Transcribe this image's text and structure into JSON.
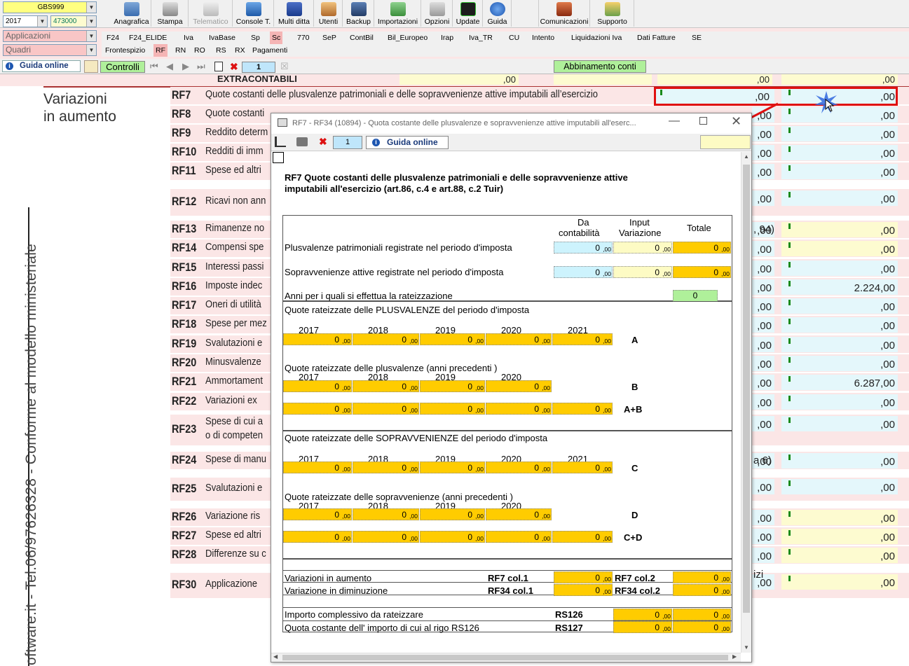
{
  "toolbar": {
    "company_code": "GBS999",
    "year": "2017",
    "code": "473000",
    "applications_label": "Applicazioni",
    "quadri_label": "Quadri",
    "buttons": [
      {
        "label": "Anagrafica",
        "icon": "address-book-icon"
      },
      {
        "label": "Stampa",
        "icon": "printer-icon"
      },
      {
        "label": "Telematico",
        "icon": "telematic-icon"
      },
      {
        "label": "Console T.",
        "icon": "console-icon"
      },
      {
        "label": "Multi ditta",
        "icon": "multi-company-icon"
      },
      {
        "label": "Utenti",
        "icon": "users-icon"
      },
      {
        "label": "Backup",
        "icon": "backup-icon"
      },
      {
        "label": "Importazioni",
        "icon": "import-icon"
      },
      {
        "label": "Opzioni",
        "icon": "wrench-icon"
      },
      {
        "label": "Update",
        "icon": "update-icon"
      },
      {
        "label": "Guida",
        "icon": "help-icon"
      },
      {
        "label": "Comunicazioni",
        "icon": "communications-icon"
      },
      {
        "label": "Supporto",
        "icon": "support-icon"
      }
    ]
  },
  "tabs1": [
    "F24",
    "F24_ELIDE",
    "Iva",
    "IvaBase",
    "Sp",
    "Sc",
    "770",
    "SeP",
    "ContBil",
    "Bil_Europeo",
    "Irap",
    "Iva_TR",
    "CU",
    "Intento",
    "Liquidazioni Iva",
    "Dati Fatture",
    "SE"
  ],
  "tabs2": [
    "Frontespizio",
    "RF",
    "RN",
    "RO",
    "RS",
    "RX",
    "Pagamenti"
  ],
  "navrow": {
    "guida_label": "Guida online",
    "controlli_label": "Controlli",
    "page": "1",
    "abbinamento_label": "Abbinamento conti"
  },
  "form": {
    "sidebar_text": "oftware.it - Tel.06/97626328 - Conforme al modello ministeriale",
    "section_title_1": "Variazioni",
    "section_title_2": "in aumento",
    "extra_label": "EXTRACONTABILI",
    "zero": ",00",
    "rows": [
      {
        "code": "RF7",
        "desc": "Quote costanti delle plusvalenze patrimoniali e delle sopravvenienze attive imputabili all’esercizio",
        "value": ",00"
      },
      {
        "code": "RF8",
        "desc": "Quote costanti",
        "value": ",00"
      },
      {
        "code": "RF9",
        "desc": "Reddito determ",
        "value": ",00"
      },
      {
        "code": "RF10",
        "desc": "Redditi di imm",
        "value": ",00"
      },
      {
        "code": "RF11",
        "desc": "Spese ed altri",
        "value": ",00"
      },
      {
        "code": "RF12",
        "desc": "Ricavi non ann",
        "value": ",00"
      },
      {
        "code": "RF13",
        "desc": "Rimanenze no",
        "value": ",00"
      },
      {
        "code": "RF14",
        "desc": "Compensi spe",
        "value": ",00"
      },
      {
        "code": "RF15",
        "desc": "Interessi passi",
        "value": ",00"
      },
      {
        "code": "RF16",
        "desc": "Imposte indec",
        "value": "2.224,00"
      },
      {
        "code": "RF17",
        "desc": "Oneri di utilità",
        "value": ",00"
      },
      {
        "code": "RF18",
        "desc": "Spese per mez",
        "value": ",00"
      },
      {
        "code": "RF19",
        "desc": "Svalutazioni e",
        "value": ",00"
      },
      {
        "code": "RF20",
        "desc": "Minusvalenze",
        "value": ",00"
      },
      {
        "code": "RF21",
        "desc": "Ammortament",
        "value": "6.287,00"
      },
      {
        "code": "RF22",
        "desc": "Variazioni ex",
        "value": ",00"
      },
      {
        "code": "RF23",
        "desc": "Spese di cui a",
        "desc2": "o di competen",
        "value": ",00"
      },
      {
        "code": "RF24",
        "desc": "Spese di manu",
        "value": ",00"
      },
      {
        "code": "RF25",
        "desc": "Svalutazioni e",
        "value": ",00"
      },
      {
        "code": "RF26",
        "desc": "Variazione ris",
        "value": ",00"
      },
      {
        "code": "RF27",
        "desc": "Spese ed altri",
        "value": ",00"
      },
      {
        "code": "RF28",
        "desc": "Differenze su c",
        "value": ",00"
      },
      {
        "code": "RF30",
        "desc": "Applicazione",
        "value": ",00"
      }
    ],
    "partial_94": ", 94)",
    "partial_a6": "a 6)",
    "partial_izi": "izi",
    "partial_5": "5)",
    "partial_rf8_mid": "0 / "
  },
  "dialog": {
    "title": "RF7 - RF34 (10894) - Quota costante delle plusvalenze e sopravvenienze attive imputabili all'eserc...",
    "page": "1",
    "guida_label": "Guida online",
    "heading_1": "RF7 Quote costanti delle plusvalenze patrimoniali e delle sopravvenienze attive",
    "heading_2": "imputabili all'esercizio (art.86, c.4 e art.88, c.2 Tuir)",
    "col_da_1": "Da",
    "col_da_2": "contabilità",
    "col_input_1": "Input",
    "col_input_2": "Variazione",
    "col_totale": "Totale",
    "row_plus": "Plusvalenze patrimoniali registrate nel periodo d'imposta",
    "row_sopr": "Sopravvenienze attive registrate nel periodo d'imposta",
    "row_anni": "Anni per i quali si effettua la rateizzazione",
    "anni_value": "0",
    "zero": "0",
    "cents": ",00",
    "sec_plus_cur": "Quote rateizzate delle PLUSVALENZE del periodo d'imposta",
    "sec_plus_prev": "Quote rateizzate delle plusvalenze  (anni precedenti )",
    "sec_sopr_cur": "Quote rateizzate delle SOPRAVVENIENZE del periodo d'imposta",
    "sec_sopr_prev": "Quote rateizzate delle sopravvenienze  (anni precedenti )",
    "years5": [
      "2017",
      "2018",
      "2019",
      "2020",
      "2021"
    ],
    "years4": [
      "2017",
      "2018",
      "2019",
      "2020"
    ],
    "label_A": "A",
    "label_B": "B",
    "label_AB": "A+B",
    "label_C": "C",
    "label_D": "D",
    "label_CD": "C+D",
    "var_aum": "Variazioni in aumento",
    "var_dim": "Variazione in diminuzione",
    "rf7_col1": "RF7 col.1",
    "rf7_col2": "RF7 col.2",
    "rf34_col1": "RF34 col.1",
    "rf34_col2": "RF34 col.2",
    "importo": "Importo complessivo da rateizzare",
    "quota": "Quota costante dell' importo di cui al rigo RS126",
    "rs126": "RS126",
    "rs127": "RS127"
  }
}
